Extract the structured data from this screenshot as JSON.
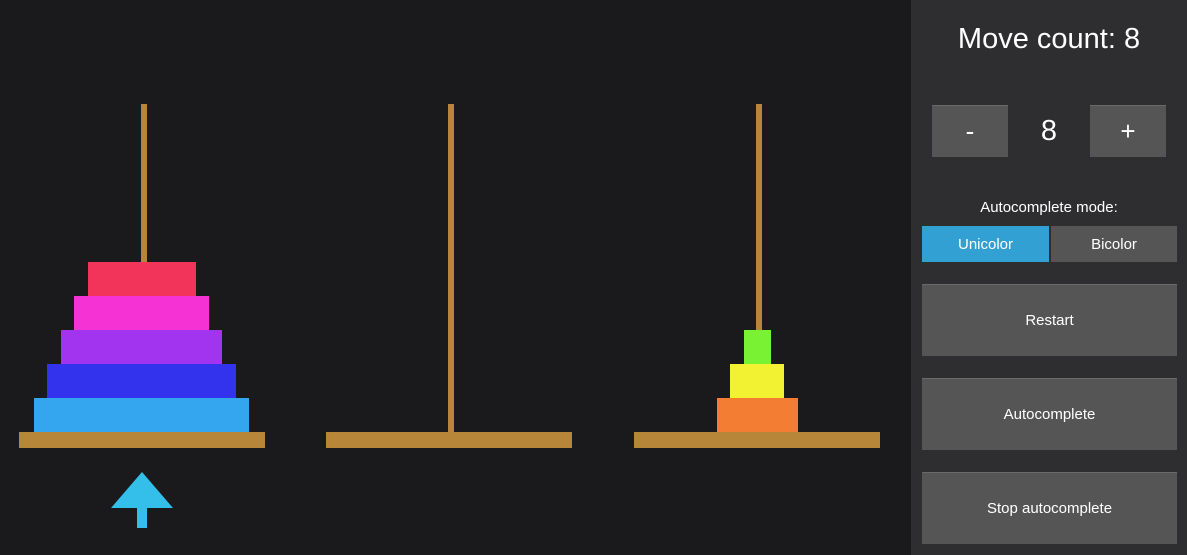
{
  "panel": {
    "move_count_label": "Move count: 8",
    "minus_label": "-",
    "plus_label": "+",
    "disk_count": "8",
    "autocomplete_mode_label": "Autocomplete mode:",
    "modes": [
      {
        "label": "Unicolor",
        "active": true
      },
      {
        "label": "Bicolor",
        "active": false
      }
    ],
    "restart_label": "Restart",
    "autocomplete_label": "Autocomplete",
    "stop_autocomplete_label": "Stop autocomplete",
    "accent_color": "#33a0d4"
  },
  "board": {
    "rod_color": "#b88638",
    "selected_tower": 0,
    "selector_icon": "up-arrow-icon",
    "selector_color": "#33bfe9",
    "towers": [
      {
        "disks": [
          {
            "size": 5,
            "color": "#33a6ef"
          },
          {
            "size": 4,
            "color": "#3333ee"
          },
          {
            "size": 3,
            "color": "#a233ee"
          },
          {
            "size": 2,
            "color": "#f533d4"
          },
          {
            "size": 1,
            "color": "#f2335a"
          }
        ]
      },
      {
        "disks": []
      },
      {
        "disks": [
          {
            "size": "small",
            "color": "#f27d33"
          },
          {
            "size": "smaller",
            "color": "#f2f233"
          },
          {
            "size": "smallest",
            "color": "#79f233"
          }
        ]
      }
    ]
  }
}
